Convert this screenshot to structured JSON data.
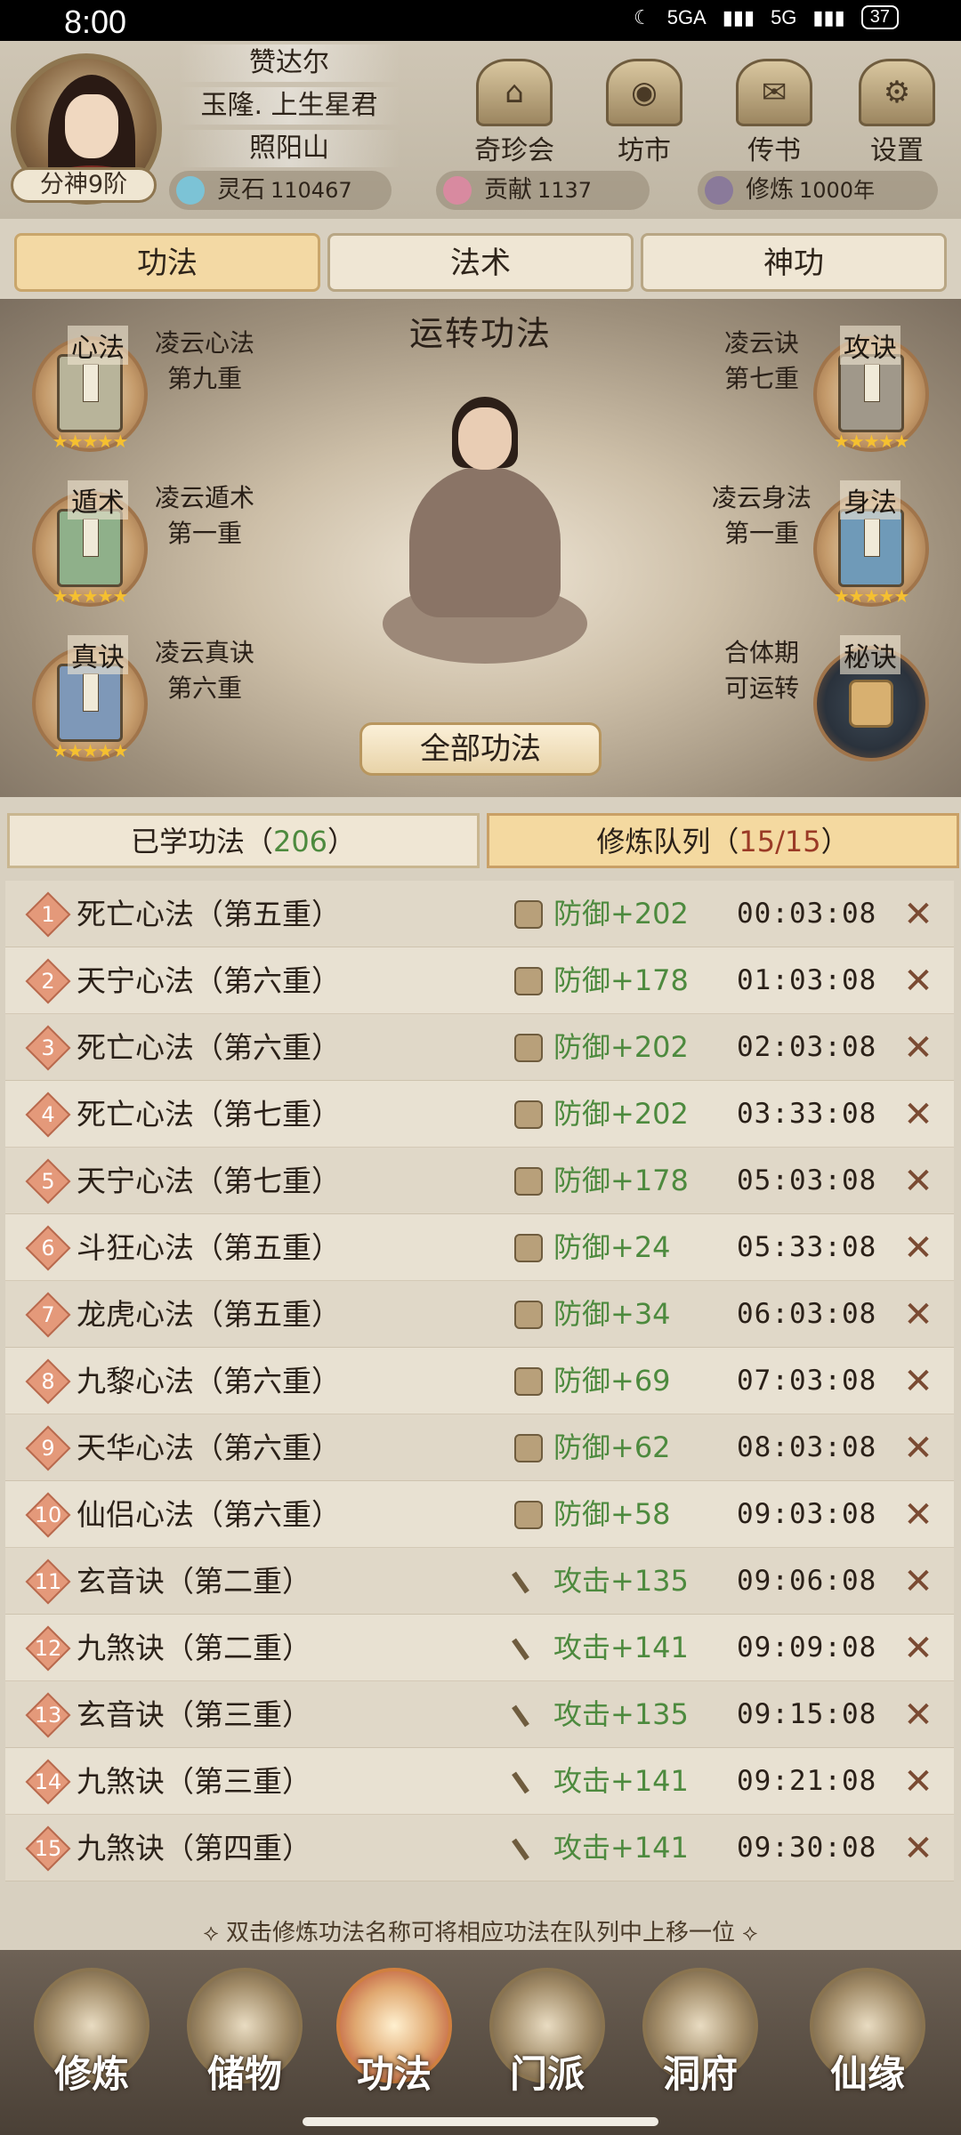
{
  "status_bar": {
    "time": "8:00",
    "network1": "5GA",
    "network2": "5G",
    "battery": "37"
  },
  "player": {
    "rank": "分神9阶",
    "name": "赞达尔",
    "title": "玉隆. 上生星君",
    "sect": "照阳山"
  },
  "top_menu": [
    {
      "label": "奇珍会",
      "icon": "treasure-pavilion-icon"
    },
    {
      "label": "坊市",
      "icon": "market-icon"
    },
    {
      "label": "传书",
      "icon": "scroll-letter-icon"
    },
    {
      "label": "设置",
      "icon": "gear-icon"
    }
  ],
  "resources": [
    {
      "label": "灵石",
      "value": "110467",
      "color": "#7cc3d6"
    },
    {
      "label": "贡献",
      "value": "1137",
      "color": "#d88aa0"
    },
    {
      "label": "修炼",
      "value": "1000年",
      "color": "#8a7a9a"
    }
  ],
  "tabs": [
    "功法",
    "法术",
    "神功"
  ],
  "active_tab": "功法",
  "scene": {
    "title": "运转功法",
    "all_button": "全部功法",
    "left_slots": [
      {
        "tag": "心法",
        "name": "凌云心法",
        "level": "第九重",
        "book_color": "#b8b49a",
        "stars": "★★★★★"
      },
      {
        "tag": "遁术",
        "name": "凌云遁术",
        "level": "第一重",
        "book_color": "#8fb08a",
        "stars": "★★★★★"
      },
      {
        "tag": "真诀",
        "name": "凌云真诀",
        "level": "第六重",
        "book_color": "#7e98b8",
        "stars": "★★★★★"
      }
    ],
    "right_slots": [
      {
        "tag": "攻诀",
        "name": "凌云诀",
        "level": "第七重",
        "book_color": "#a0988a",
        "stars": "★★★★★"
      },
      {
        "tag": "身法",
        "name": "凌云身法",
        "level": "第一重",
        "book_color": "#6f9ab8",
        "stars": "★★★★★"
      },
      {
        "tag": "秘诀",
        "name": "合体期",
        "level": "可运转",
        "locked": true
      }
    ]
  },
  "queue_tabs": {
    "learned_label": "已学功法（",
    "learned_count": "206",
    "learned_suffix": "）",
    "queue_label": "修炼队列（",
    "queue_count": "15/15",
    "queue_suffix": "）"
  },
  "queue": [
    {
      "n": "1",
      "name": "死亡心法（第五重）",
      "stat": "防御+202",
      "type": "def",
      "time": "00:03:08"
    },
    {
      "n": "2",
      "name": "天宁心法（第六重）",
      "stat": "防御+178",
      "type": "def",
      "time": "01:03:08"
    },
    {
      "n": "3",
      "name": "死亡心法（第六重）",
      "stat": "防御+202",
      "type": "def",
      "time": "02:03:08"
    },
    {
      "n": "4",
      "name": "死亡心法（第七重）",
      "stat": "防御+202",
      "type": "def",
      "time": "03:33:08"
    },
    {
      "n": "5",
      "name": "天宁心法（第七重）",
      "stat": "防御+178",
      "type": "def",
      "time": "05:03:08"
    },
    {
      "n": "6",
      "name": "斗狂心法（第五重）",
      "stat": "防御+24",
      "type": "def",
      "time": "05:33:08"
    },
    {
      "n": "7",
      "name": "龙虎心法（第五重）",
      "stat": "防御+34",
      "type": "def",
      "time": "06:03:08"
    },
    {
      "n": "8",
      "name": "九黎心法（第六重）",
      "stat": "防御+69",
      "type": "def",
      "time": "07:03:08"
    },
    {
      "n": "9",
      "name": "天华心法（第六重）",
      "stat": "防御+62",
      "type": "def",
      "time": "08:03:08"
    },
    {
      "n": "10",
      "name": "仙侣心法（第六重）",
      "stat": "防御+58",
      "type": "def",
      "time": "09:03:08"
    },
    {
      "n": "11",
      "name": "玄音诀（第二重）",
      "stat": "攻击+135",
      "type": "atk",
      "time": "09:06:08"
    },
    {
      "n": "12",
      "name": "九煞诀（第二重）",
      "stat": "攻击+141",
      "type": "atk",
      "time": "09:09:08"
    },
    {
      "n": "13",
      "name": "玄音诀（第三重）",
      "stat": "攻击+135",
      "type": "atk",
      "time": "09:15:08"
    },
    {
      "n": "14",
      "name": "九煞诀（第三重）",
      "stat": "攻击+141",
      "type": "atk",
      "time": "09:21:08"
    },
    {
      "n": "15",
      "name": "九煞诀（第四重）",
      "stat": "攻击+141",
      "type": "atk",
      "time": "09:30:08"
    }
  ],
  "hint": "双击修炼功法名称可将相应功法在队列中上移一位",
  "bottom_nav": [
    {
      "label": "修炼",
      "icon": "cultivation-icon"
    },
    {
      "label": "储物",
      "icon": "storage-bag-icon"
    },
    {
      "label": "功法",
      "icon": "technique-scroll-icon",
      "active": true
    },
    {
      "label": "门派",
      "icon": "sect-gate-icon"
    },
    {
      "label": "洞府",
      "icon": "cave-abode-icon"
    },
    {
      "label": "仙缘",
      "icon": "immortal-fate-icon"
    }
  ]
}
